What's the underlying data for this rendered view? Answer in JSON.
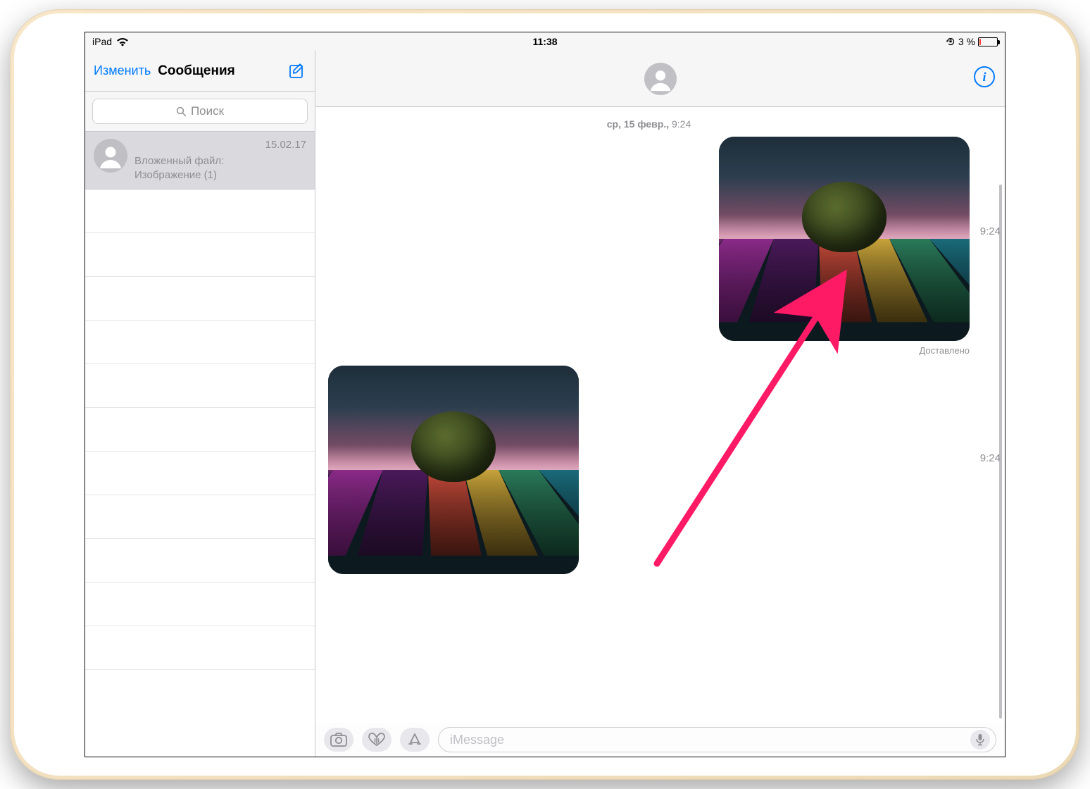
{
  "status": {
    "device": "iPad",
    "time": "11:38",
    "battery_text": "3 %"
  },
  "sidebar": {
    "edit_label": "Изменить",
    "title": "Сообщения",
    "search_placeholder": "Поиск",
    "conversation": {
      "date": "15.02.17",
      "preview_line1": "Вложенный файл:",
      "preview_line2": "Изображение (1)"
    }
  },
  "chat": {
    "date_header_prefix": "ср, 15 февр.,",
    "date_header_time": "9:24",
    "delivered_label": "Доставлено",
    "time_label_1": "9:24",
    "time_label_2": "9:24",
    "compose_placeholder": "iMessage"
  },
  "info_glyph": "i"
}
